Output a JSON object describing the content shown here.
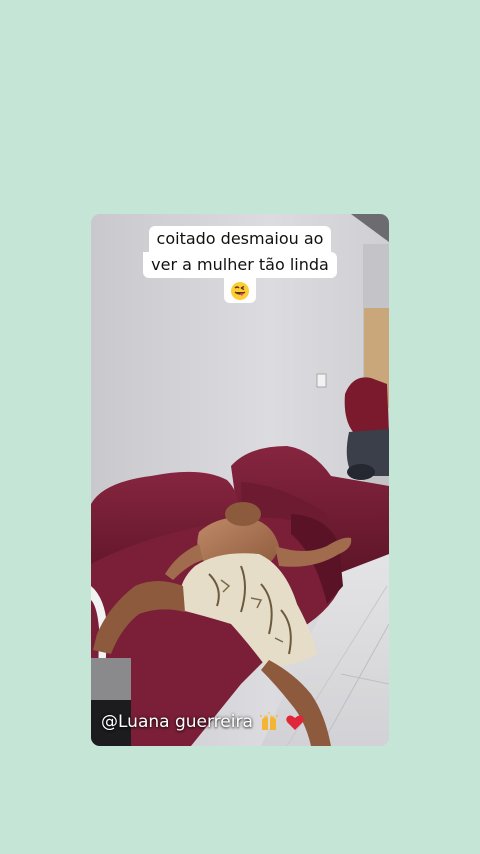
{
  "caption": {
    "line1": "coitado desmaiou ao",
    "line2": "ver a mulher tão linda",
    "emoji": "winking-tongue-face-emoji"
  },
  "credit": {
    "text": "@Luana guerreira",
    "icons": [
      "raised-hands-emoji",
      "red-heart-emoji"
    ]
  },
  "colors": {
    "background": "#c5e6d7",
    "sofa": "#7a1f37",
    "wall": "#d6d6da"
  }
}
